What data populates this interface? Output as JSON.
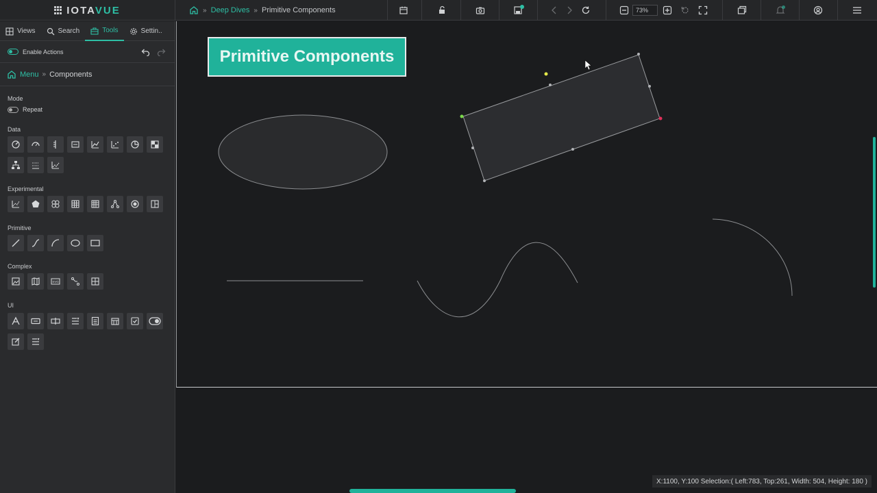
{
  "app": {
    "brand_prefix": "IOTA",
    "brand_suffix": "VUE"
  },
  "breadcrumb": {
    "parent": "Deep Dives",
    "current": "Primitive Components"
  },
  "toolbar": {
    "zoom": "73%"
  },
  "sidebar": {
    "tabs": [
      {
        "label": "Views",
        "icon": "grid-icon"
      },
      {
        "label": "Search",
        "icon": "search-icon"
      },
      {
        "label": "Tools",
        "icon": "toolbox-icon"
      },
      {
        "label": "Settin..",
        "icon": "gear-icon"
      }
    ],
    "enable_actions": "Enable Actions",
    "menu_crumb": {
      "root": "Menu",
      "current": "Components"
    },
    "mode_label": "Mode",
    "repeat_label": "Repeat",
    "sections": {
      "data": "Data",
      "experimental": "Experimental",
      "primitive": "Primitive",
      "complex": "Complex",
      "ui": "UI"
    }
  },
  "canvas": {
    "title": "Primitive Components"
  },
  "status": {
    "text": "X:1100, Y:100  Selection:( Left:783, Top:261, Width: 504, Height: 180 )"
  },
  "colors": {
    "accent": "#2ebfa5",
    "background": "#1b1c1e",
    "panel": "#2a2b2d"
  }
}
